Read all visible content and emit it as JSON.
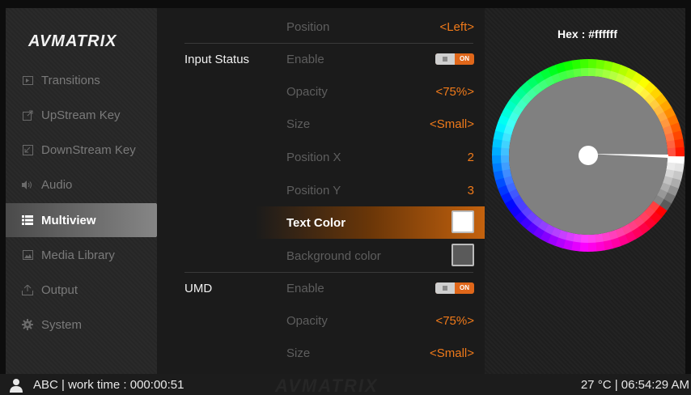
{
  "brand": {
    "logo": "AVMATRIX"
  },
  "sidebar": {
    "items": [
      {
        "label": "Transitions",
        "icon": "transitions-icon",
        "active": false
      },
      {
        "label": "UpStream Key",
        "icon": "upstream-key-icon",
        "active": false
      },
      {
        "label": "DownStream Key",
        "icon": "downstream-key-icon",
        "active": false
      },
      {
        "label": "Audio",
        "icon": "speaker-icon",
        "active": false
      },
      {
        "label": "Multiview",
        "icon": "list-icon",
        "active": true
      },
      {
        "label": "Media Library",
        "icon": "image-icon",
        "active": false
      },
      {
        "label": "Output",
        "icon": "upload-icon",
        "active": false
      },
      {
        "label": "System",
        "icon": "gear-icon",
        "active": false
      }
    ]
  },
  "settings": {
    "rows": [
      {
        "group": "",
        "label": "Position",
        "value": "<Left>"
      },
      {
        "group": "Input Status",
        "label": "Enable",
        "toggle": "ON"
      },
      {
        "group": "",
        "label": "Opacity",
        "value": "<75%>"
      },
      {
        "group": "",
        "label": "Size",
        "value": "<Small>"
      },
      {
        "group": "",
        "label": "Position X",
        "value": "2"
      },
      {
        "group": "",
        "label": "Position Y",
        "value": "3"
      },
      {
        "group": "",
        "label": "Text Color",
        "swatch": "#ffffff",
        "highlighted": true
      },
      {
        "group": "",
        "label": "Background color",
        "swatch": "#5a5a5a"
      },
      {
        "group": "UMD",
        "label": "Enable",
        "toggle": "ON"
      },
      {
        "group": "",
        "label": "Opacity",
        "value": "<75%>"
      },
      {
        "group": "",
        "label": "Size",
        "value": "<Small>"
      }
    ]
  },
  "color_picker": {
    "hex_label": "Hex : #ffffff",
    "selected_color": "#ffffff"
  },
  "statusbar": {
    "user": "ABC | work time : 000:00:51",
    "watermark": "AVMATRIX",
    "right": "27 °C | 06:54:29 AM"
  },
  "colors": {
    "accent": "#f07a1a",
    "toggle_on": "#e0671a",
    "panel_bg": "#1b1b1b"
  }
}
